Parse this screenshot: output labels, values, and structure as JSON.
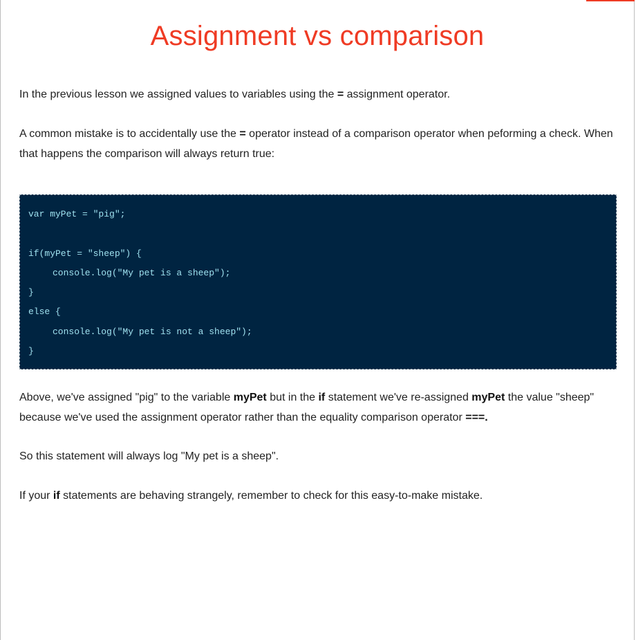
{
  "page": {
    "title": "Assignment vs comparison",
    "accent_color": "#ef3b24",
    "code_bg_color": "#002441",
    "code_text_color": "#9fe0ee"
  },
  "paragraph1": {
    "before": "In the previous lesson we assigned values to variables using the ",
    "op": "=",
    "after": " assignment operator."
  },
  "paragraph2": {
    "before": "A common mistake is to accidentally use the ",
    "op": "=",
    "after": " operator instead of a comparison operator when peforming a check. When that happens the comparison will always return true:"
  },
  "code": {
    "lines": [
      "var myPet = \"pig\";",
      "",
      "if(myPet = \"sheep\") {",
      "console.log(\"My pet is a sheep\");",
      "}",
      "else {",
      "console.log(\"My pet is not a sheep\");",
      "}"
    ]
  },
  "paragraph3": {
    "t1": "Above, we've assigned \"pig\" to the variable ",
    "b1": "myPet",
    "t2": " but in the ",
    "b2": "if",
    "t3": " statement we've re-assigned ",
    "b3": "myPet",
    "t4": " the value \"sheep\" because we've used the assignment operator rather than the equality comparison operator ",
    "b4": "===."
  },
  "paragraph4": {
    "text": "So this statement will always log \"My pet is a sheep\"."
  },
  "paragraph5": {
    "before": "If your ",
    "bold": "if",
    "after": " statements are behaving strangely, remember to check for this easy-to-make mistake."
  }
}
